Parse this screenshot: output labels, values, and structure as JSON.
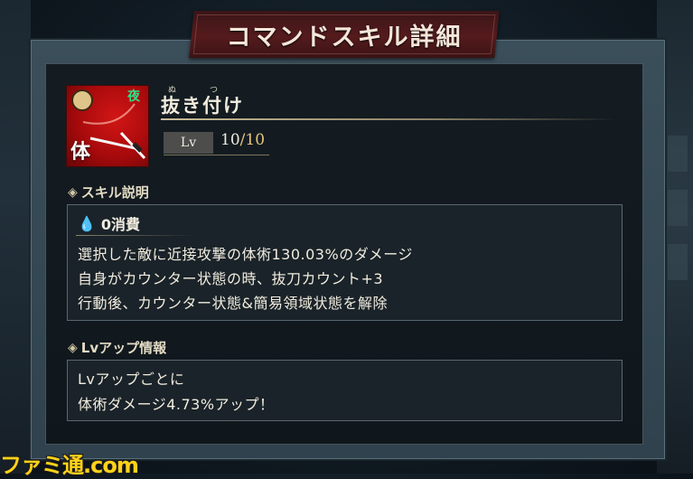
{
  "dialog": {
    "title": "コマンドスキル詳細"
  },
  "skill": {
    "icon_name": "katana-slash-icon",
    "type_glyph": "体",
    "time_badge": "夜",
    "ruby_1": "ぬ",
    "ruby_2": "つ",
    "name": "抜き付け",
    "lv_label": "Lv",
    "lv_current": "10",
    "lv_separator": "/",
    "lv_max": "10"
  },
  "skill_description": {
    "heading": "スキル説明",
    "cost": "0消費",
    "lines": [
      "選択した敵に近接攻撃の体術130.03%のダメージ",
      "自身がカウンター状態の時、抜刀カウント+3",
      "行動後、カウンター状態&簡易領域状態を解除"
    ]
  },
  "lv_up_info": {
    "heading": "Lvアップ情報",
    "lines": [
      "Lvアップごとに",
      "体術ダメージ4.73%アップ！"
    ]
  },
  "watermark": "ファミ通.com",
  "colors": {
    "banner": "#551b1d",
    "icon_bg": "#c01010",
    "accent_gold": "#e7c77c",
    "drop": "#4fc6ff"
  }
}
